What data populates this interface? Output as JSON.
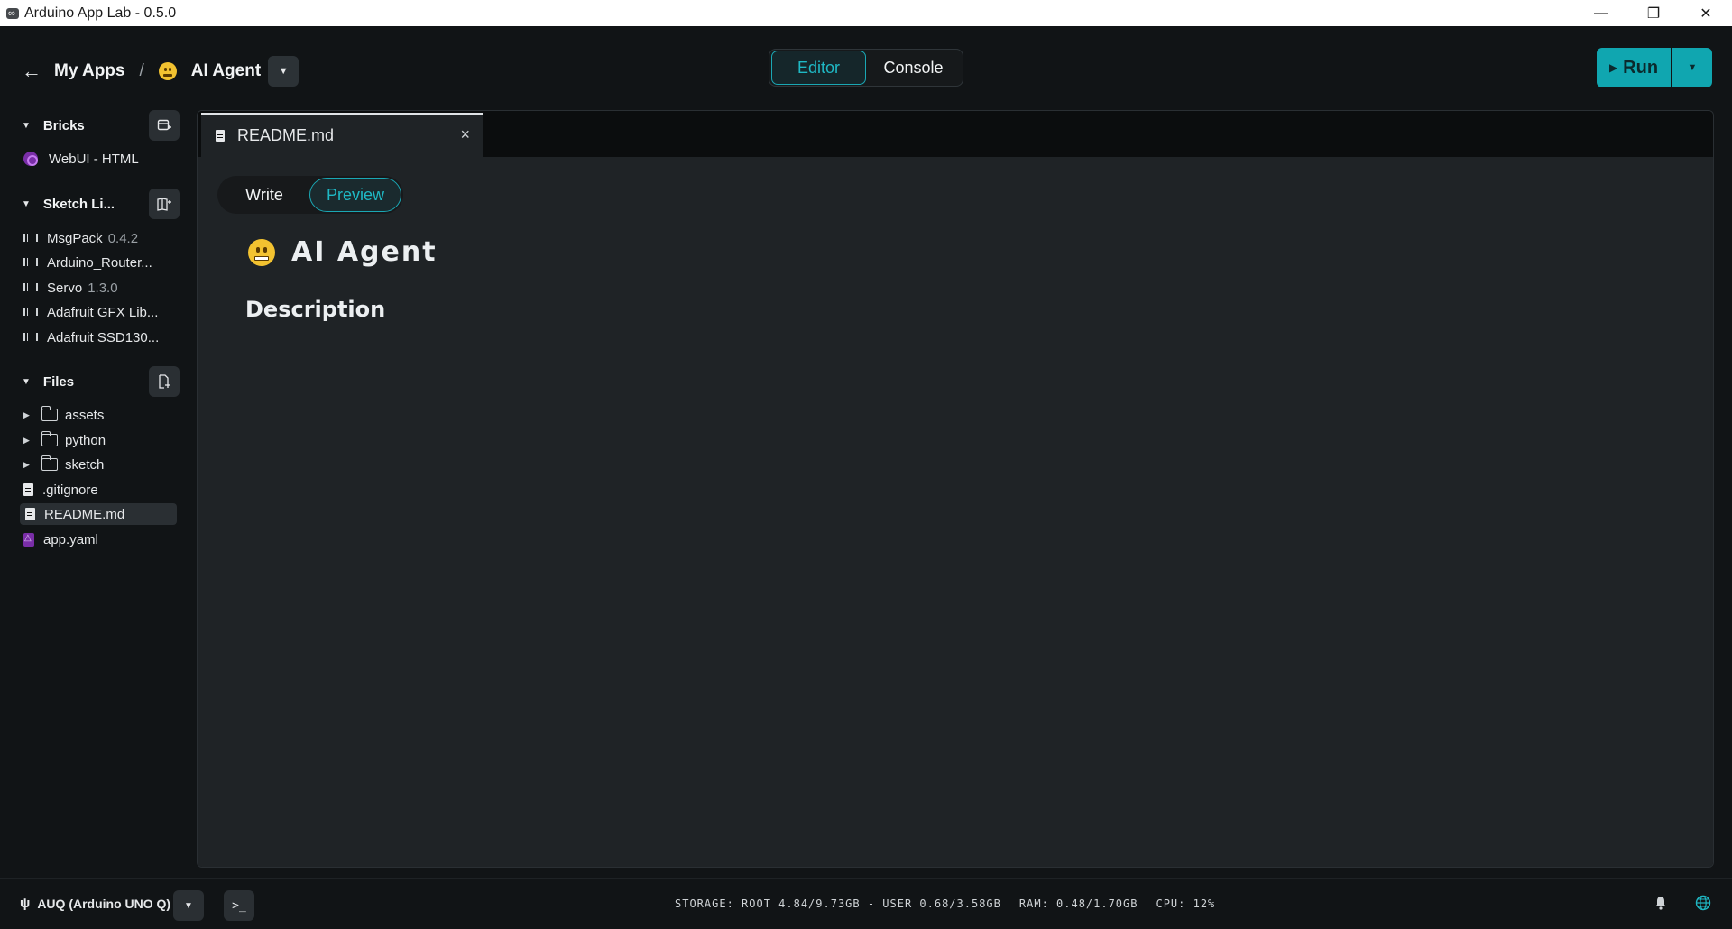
{
  "window": {
    "title": "Arduino App Lab - 0.5.0",
    "controls": {
      "minimize": "—",
      "restore": "❐",
      "close": "✕"
    }
  },
  "header": {
    "back_icon": "arrow-left-icon",
    "breadcrumb": {
      "root": "My Apps",
      "separator": "/",
      "app_name": "AI Agent",
      "app_emoji": "grimacing-face"
    },
    "views": {
      "editor": "Editor",
      "console": "Console",
      "active": "Editor"
    },
    "run": {
      "label": "Run",
      "icon": "play-icon"
    }
  },
  "sidebar": {
    "bricks": {
      "title": "Bricks",
      "items": [
        {
          "label": "WebUI - HTML"
        }
      ]
    },
    "sketch_libraries": {
      "title": "Sketch Li...",
      "items": [
        {
          "name": "MsgPack",
          "version": "0.4.2"
        },
        {
          "name": "Arduino_Router...",
          "version": ""
        },
        {
          "name": "Servo",
          "version": "1.3.0"
        },
        {
          "name": "Adafruit GFX Lib...",
          "version": ""
        },
        {
          "name": "Adafruit SSD130...",
          "version": ""
        }
      ]
    },
    "files": {
      "title": "Files",
      "folders": [
        "assets",
        "python",
        "sketch"
      ],
      "files": [
        ".gitignore",
        "README.md",
        "app.yaml"
      ],
      "selected": "README.md"
    }
  },
  "editor": {
    "tab": {
      "label": "README.md"
    },
    "mode": {
      "write": "Write",
      "preview": "Preview",
      "active": "Preview"
    },
    "preview": {
      "title": "AI Agent",
      "heading": "Description"
    }
  },
  "statusbar": {
    "board": "AUQ (Arduino UNO Q)",
    "terminal_glyph": ">_",
    "storage": "STORAGE: ROOT 4.84/9.73GB - USER 0.68/3.58GB",
    "ram": "RAM: 0.48/1.70GB",
    "cpu": "CPU: 12%"
  },
  "colors": {
    "accent": "#10a6b0",
    "background": "#111416",
    "panel": "#1f2326"
  }
}
